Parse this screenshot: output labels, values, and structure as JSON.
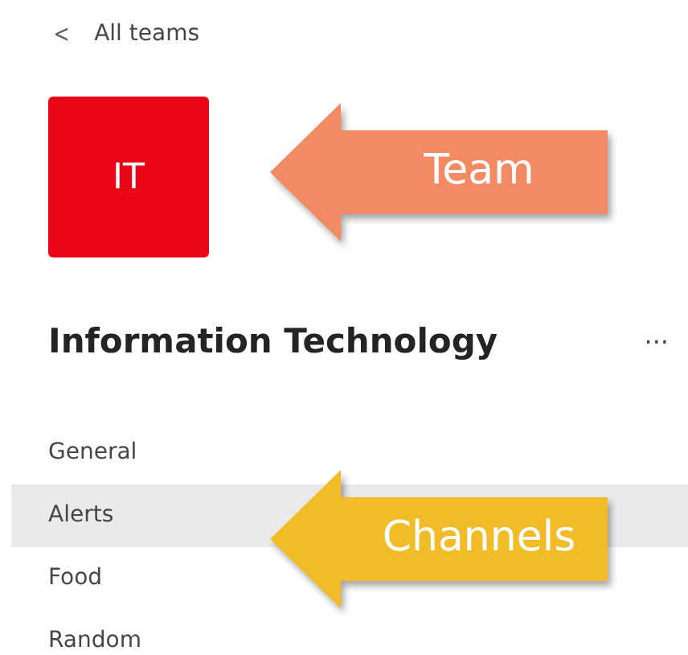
{
  "back_link": {
    "icon": "<",
    "label": "All teams"
  },
  "team": {
    "initials": "IT",
    "color": "#eb0519",
    "name": "Information Technology",
    "more": "···"
  },
  "channels": [
    {
      "name": "General",
      "selected": false
    },
    {
      "name": "Alerts",
      "selected": true
    },
    {
      "name": "Food",
      "selected": false
    },
    {
      "name": "Random",
      "selected": false
    }
  ],
  "callouts": [
    {
      "label": "Team",
      "color": "#f28a64"
    },
    {
      "label": "Channels",
      "color": "#f2bc29"
    }
  ]
}
